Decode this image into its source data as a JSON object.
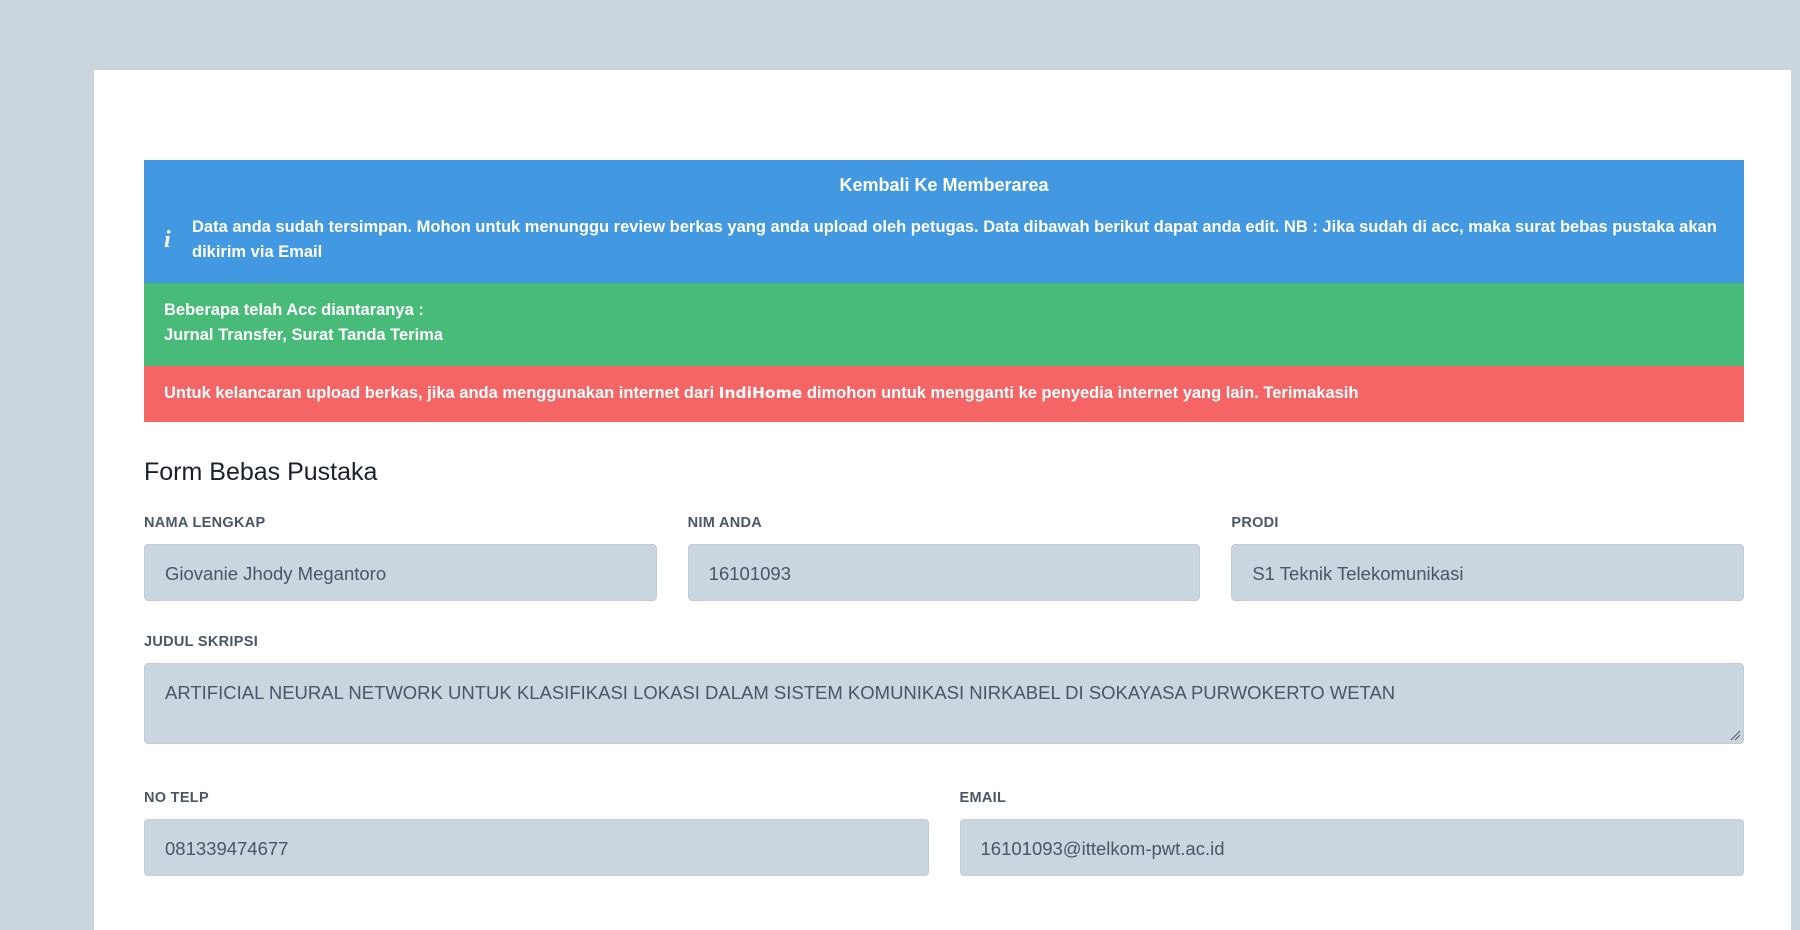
{
  "notice": {
    "back_link": "Kembali Ke Memberarea",
    "info_text": "Data anda sudah tersimpan. Mohon untuk menunggu review berkas yang anda upload oleh petugas. Data dibawah berikut dapat anda edit. NB : Jika sudah di acc, maka surat bebas pustaka akan dikirim via Email",
    "info_icon": "info-icon"
  },
  "acc": {
    "line1": "Beberapa telah Acc diantaranya :",
    "line2": "Jurnal Transfer, Surat Tanda Terima"
  },
  "warning": {
    "before": "Untuk kelancaran upload berkas, jika anda menggunakan internet dari ",
    "brand": "IndiHome",
    "after": " dimohon untuk mengganti ke penyedia internet yang lain. Terimakasih"
  },
  "form": {
    "title": "Form Bebas Pustaka",
    "nama": {
      "label": "NAMA LENGKAP",
      "value": "Giovanie Jhody Megantoro"
    },
    "nim": {
      "label": "NIM ANDA",
      "value": "16101093"
    },
    "prodi": {
      "label": "PRODI",
      "value": "S1 Teknik Telekomunikasi"
    },
    "judul": {
      "label": "JUDUL SKRIPSI",
      "value": "ARTIFICIAL NEURAL NETWORK UNTUK KLASIFIKASI LOKASI DALAM SISTEM KOMUNIKASI NIRKABEL DI SOKAYASA PURWOKERTO WETAN"
    },
    "telp": {
      "label": "NO TELP",
      "value": "081339474677"
    },
    "email": {
      "label": "EMAIL",
      "value": "16101093@ittelkom-pwt.ac.id"
    }
  },
  "colors": {
    "page_bg": "#cbd5e0",
    "info": "#4299e1",
    "success": "#48bb78",
    "danger": "#f56565",
    "input_bg": "#cbd5e0"
  }
}
